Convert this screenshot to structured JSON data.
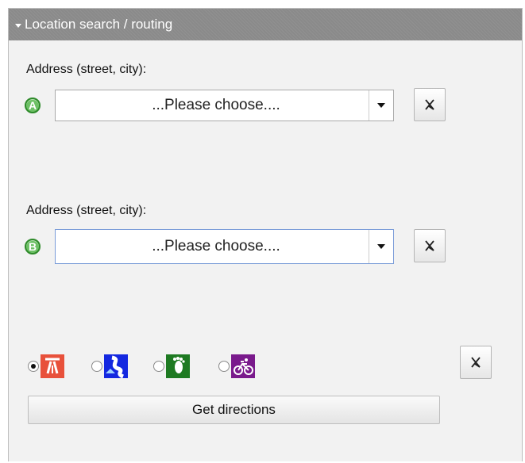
{
  "panel": {
    "title": "Location search / routing",
    "address_a": {
      "label": "Address (street, city):",
      "badge": "A",
      "select_value": "...Please choose...."
    },
    "address_b": {
      "label": "Address (street, city):",
      "badge": "B",
      "select_value": "...Please choose...."
    },
    "transport_modes": [
      {
        "name": "car-motorway",
        "color": "#e8513b",
        "selected": true
      },
      {
        "name": "scenic-road",
        "color": "#1428e0",
        "selected": false
      },
      {
        "name": "walking",
        "color": "#1e7a22",
        "selected": false
      },
      {
        "name": "cycling",
        "color": "#7a1a8c",
        "selected": false
      }
    ],
    "get_directions_label": "Get directions"
  },
  "colors": {
    "header_bg": "#8a8a8a",
    "panel_bg": "#f2f2f2",
    "badge_green": "#6dc065"
  }
}
